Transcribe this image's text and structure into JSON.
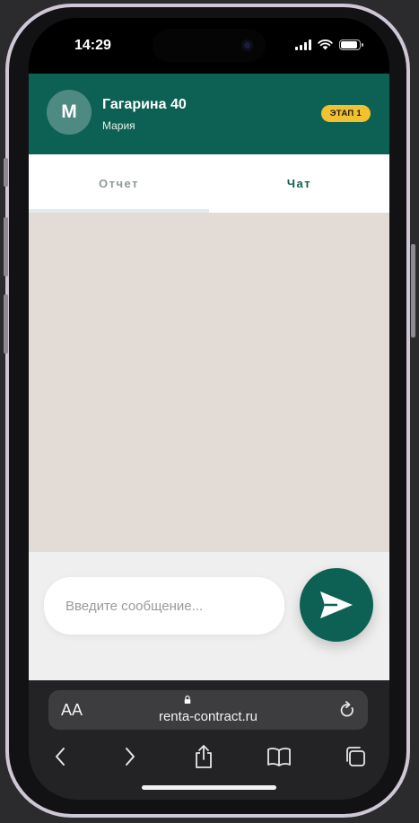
{
  "status_bar": {
    "time": "14:29"
  },
  "header": {
    "avatar_letter": "M",
    "title": "Гагарина 40",
    "subtitle": "Мария",
    "stage_badge": "ЭТАП 1",
    "background_color": "#0d6154",
    "badge_color": "#f2c12e"
  },
  "tabs": [
    {
      "label": "Отчет",
      "active": false
    },
    {
      "label": "Чат",
      "active": true
    }
  ],
  "composer": {
    "placeholder": "Введите сообщение...",
    "value": "",
    "send_icon": "send-icon"
  },
  "browser": {
    "text_size_label": "AA",
    "url": "renta-contract.ru",
    "icons": [
      "lock-icon",
      "reload-icon",
      "back-icon",
      "forward-icon",
      "share-icon",
      "bookmarks-icon",
      "tabs-icon"
    ]
  }
}
